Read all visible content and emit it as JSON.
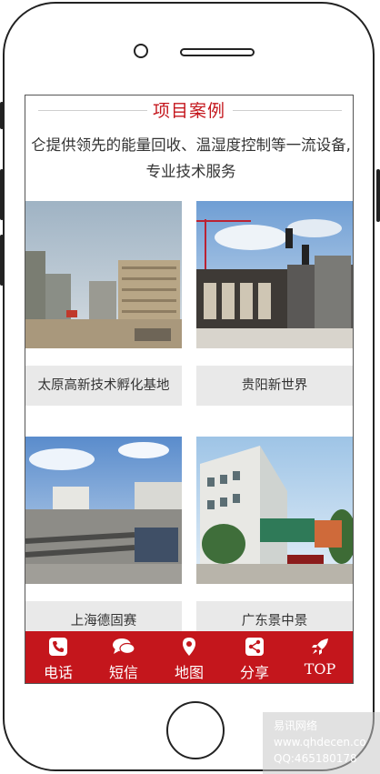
{
  "section": {
    "title": "项目案例",
    "intro_line1": "仑提供领先的能量回收、温湿度控制等一流设备,",
    "intro_line2": "专业技术服务"
  },
  "cases": [
    {
      "label": "太原高新技术孵化基地",
      "image": "construction-site-photo"
    },
    {
      "label": "贵阳新世界",
      "image": "city-construction-photo"
    },
    {
      "label": "上海德固赛",
      "image": "rooftop-equipment-photo"
    },
    {
      "label": "广东景中景",
      "image": "factory-building-photo"
    }
  ],
  "bottom_nav": [
    {
      "label": "电话",
      "icon": "phone-icon"
    },
    {
      "label": "短信",
      "icon": "chat-icon"
    },
    {
      "label": "地图",
      "icon": "map-pin-icon"
    },
    {
      "label": "分享",
      "icon": "share-icon"
    },
    {
      "label": "TOP",
      "icon": "rocket-icon"
    }
  ],
  "watermark": {
    "line1": "易讯网络",
    "line2": "www.qhdecen.co",
    "line3": "QQ:465180178"
  },
  "colors": {
    "accent": "#c4161c",
    "label_bg": "#e9e9e9"
  }
}
